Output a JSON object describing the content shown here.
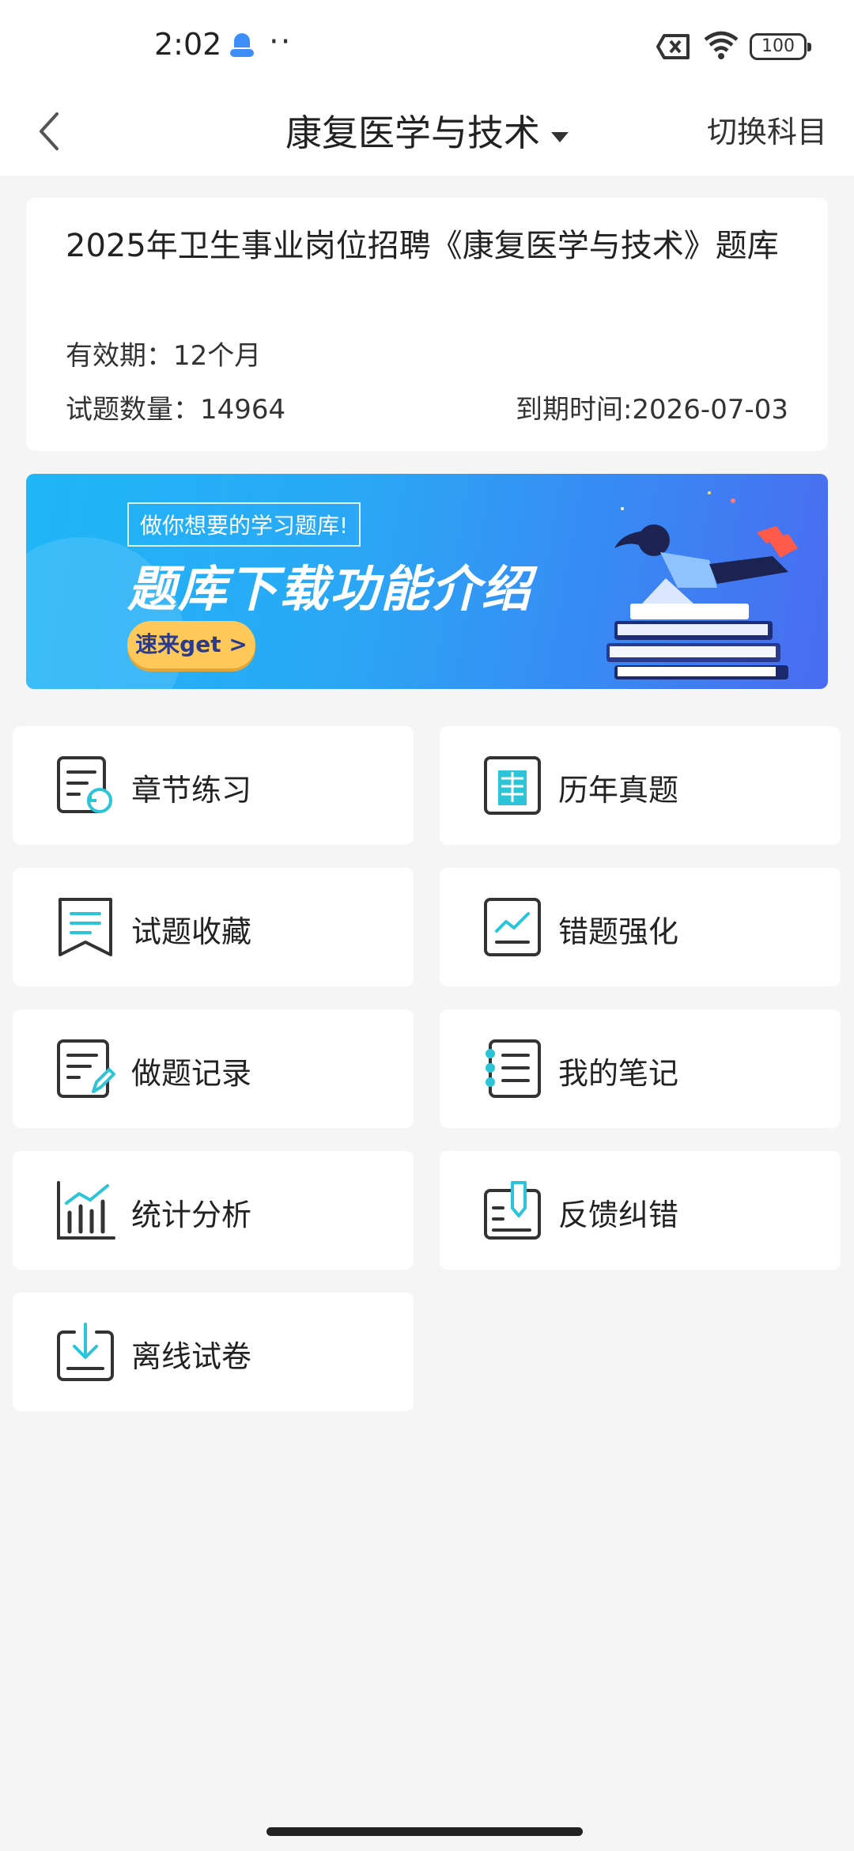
{
  "status_bar": {
    "time": "2:02",
    "battery": "100"
  },
  "header": {
    "title": "康复医学与技术",
    "switch_label": "切换科目"
  },
  "info": {
    "title": "2025年卫生事业岗位招聘《康复医学与技术》题库",
    "validity": "有效期：12个月",
    "question_count": "试题数量：14964",
    "expiry": "到期时间:2026-07-03"
  },
  "banner": {
    "tag": "做你想要的学习题库!",
    "headline": "题库下载功能介绍",
    "cta": "速来get >"
  },
  "menu": [
    {
      "label": "章节练习",
      "icon": "chapter-practice-icon"
    },
    {
      "label": "历年真题",
      "icon": "past-exam-icon"
    },
    {
      "label": "试题收藏",
      "icon": "bookmark-icon"
    },
    {
      "label": "错题强化",
      "icon": "wrong-question-icon"
    },
    {
      "label": "做题记录",
      "icon": "practice-record-icon"
    },
    {
      "label": "我的笔记",
      "icon": "notebook-icon"
    },
    {
      "label": "统计分析",
      "icon": "statistics-icon"
    },
    {
      "label": "反馈纠错",
      "icon": "feedback-icon"
    },
    {
      "label": "离线试卷",
      "icon": "offline-download-icon"
    }
  ],
  "colors": {
    "accent": "#2cc5d8",
    "icon_stroke": "#333333",
    "banner_from": "#1fb6f6",
    "banner_to": "#4a6cf0"
  }
}
